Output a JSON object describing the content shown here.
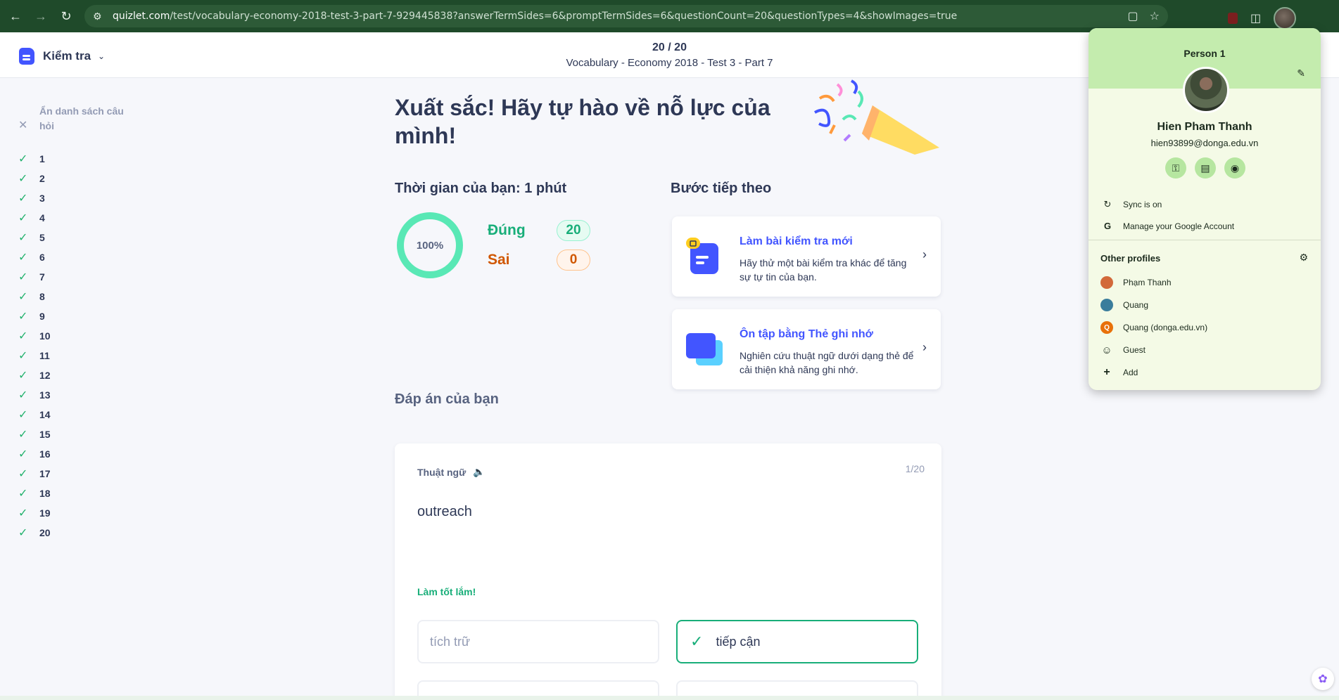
{
  "browser": {
    "url_host": "quizlet.com",
    "url_path": "/test/vocabulary-economy-2018-test-3-part-7-929445838?answerTermSides=6&promptTermSides=6&questionCount=20&questionTypes=4&showImages=true"
  },
  "header": {
    "mode_label": "Kiểm tra",
    "progress": "20 / 20",
    "set_title": "Vocabulary - Economy 2018 - Test 3 - Part 7"
  },
  "sidebar": {
    "hide_label": "Ẩn danh sách câu hỏi",
    "questions": [
      "1",
      "2",
      "3",
      "4",
      "5",
      "6",
      "7",
      "8",
      "9",
      "10",
      "11",
      "12",
      "13",
      "14",
      "15",
      "16",
      "17",
      "18",
      "19",
      "20"
    ]
  },
  "result": {
    "headline": "Xuất sắc! Hãy tự hào về nỗ lực của mình!",
    "time_title": "Thời gian của bạn: 1 phút",
    "percent_label": "100%",
    "percent_value": 100,
    "correct_label": "Đúng",
    "correct_count": "20",
    "wrong_label": "Sai",
    "wrong_count": "0"
  },
  "next_steps": {
    "title": "Bước tiếp theo",
    "cards": [
      {
        "title": "Làm bài kiểm tra mới",
        "desc": "Hãy thử một bài kiểm tra khác để tăng sự tự tin của bạn."
      },
      {
        "title": "Ôn tập bằng Thẻ ghi nhớ",
        "desc": "Nghiên cứu thuật ngữ dưới dạng thẻ để cải thiện khả năng ghi nhớ."
      }
    ]
  },
  "answers": {
    "title": "Đáp án của bạn",
    "card": {
      "label": "Thuật ngữ",
      "index": "1/20",
      "term": "outreach",
      "feedback": "Làm tốt lắm!",
      "options": [
        "tích trữ",
        "tiếp cận"
      ]
    }
  },
  "profile": {
    "person_label": "Person 1",
    "name": "Hien Pham Thanh",
    "email": "hien93899@donga.edu.vn",
    "sync": "Sync is on",
    "manage": "Manage your Google Account",
    "other_title": "Other profiles",
    "others": [
      "Phạm Thanh",
      "Quang",
      "Quang (donga.edu.vn)",
      "Guest",
      "Add"
    ],
    "other_initials": {
      "quang_donga": "Q"
    }
  },
  "colors": {
    "brand": "#4255ff",
    "success": "#18ae79",
    "warning": "#d05700",
    "chrome": "#1f4a2a"
  }
}
